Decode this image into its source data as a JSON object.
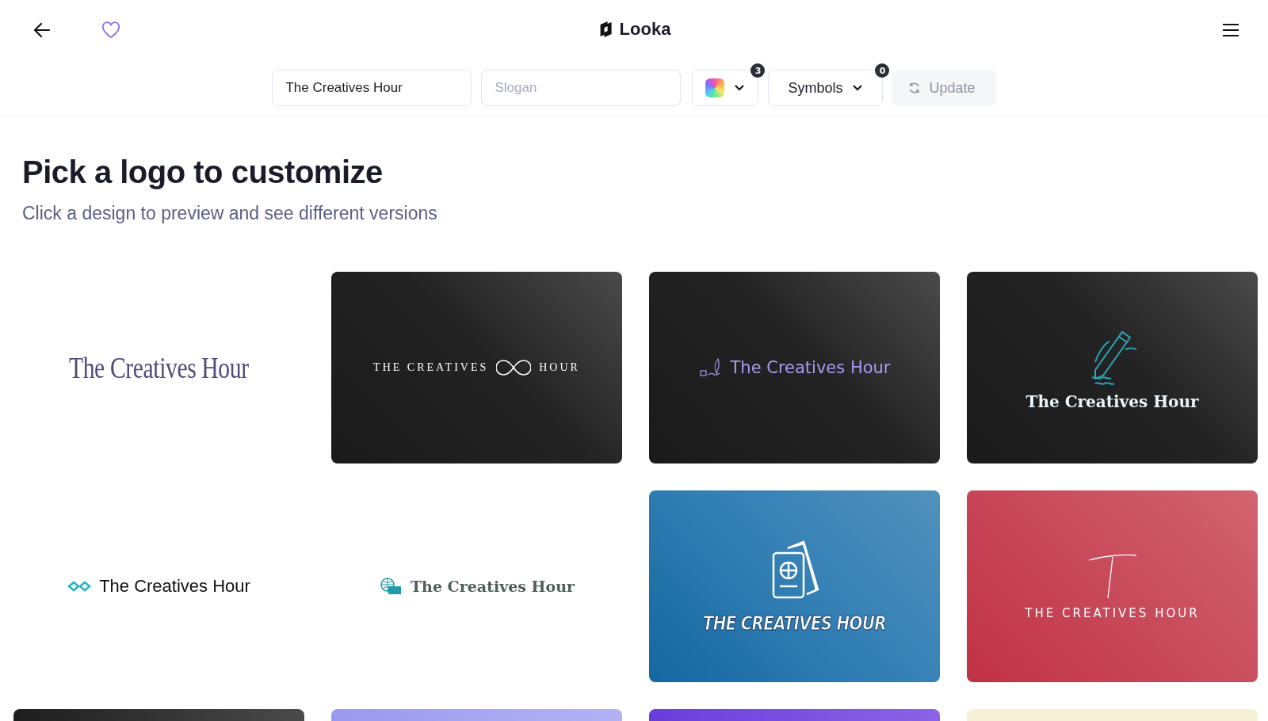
{
  "header": {
    "brand": "Looka"
  },
  "toolbar": {
    "name_field": {
      "value": "The Creatives Hour"
    },
    "slogan_field": {
      "placeholder": "Slogan"
    },
    "colors": {
      "count": "3"
    },
    "symbols": {
      "label": "Symbols",
      "count": "0"
    },
    "update": {
      "label": "Update",
      "disabled": true
    }
  },
  "heading": {
    "title": "Pick a logo to customize",
    "subtitle": "Click a design to preview and see different versions"
  },
  "cards": [
    {
      "kind": "condensed",
      "text": "The Creatives Hour"
    },
    {
      "kind": "infinity",
      "text": "THE CREATIVES",
      "text_2": "HOUR"
    },
    {
      "kind": "feather",
      "text": "The Creatives Hour"
    },
    {
      "kind": "pencil",
      "text": "The Creatives Hour"
    },
    {
      "kind": "diamonds",
      "text": "The Creatives Hour"
    },
    {
      "kind": "globe",
      "text": "The Creatives Hour"
    },
    {
      "kind": "passport",
      "text": "THE CREATIVES HOUR"
    },
    {
      "kind": "letter",
      "text": "THE CREATIVES HOUR"
    },
    {
      "kind": "charcoal"
    },
    {
      "kind": "lavender"
    },
    {
      "kind": "violet"
    },
    {
      "kind": "cream"
    }
  ]
}
